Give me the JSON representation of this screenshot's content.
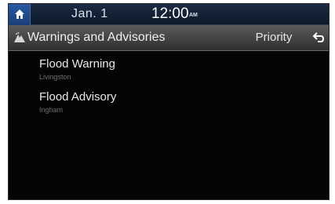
{
  "status_bar": {
    "date": "Jan. 1",
    "time": "12:00",
    "ampm": "AM"
  },
  "header": {
    "title": "Warnings and Advisories",
    "priority_label": "Priority"
  },
  "warnings": [
    {
      "title": "Flood Warning",
      "location": "Livingston"
    },
    {
      "title": "Flood Advisory",
      "location": "Ingham"
    }
  ],
  "icons": {
    "home": "home-icon",
    "alert": "alert-icon",
    "back": "back-arrow-icon"
  }
}
